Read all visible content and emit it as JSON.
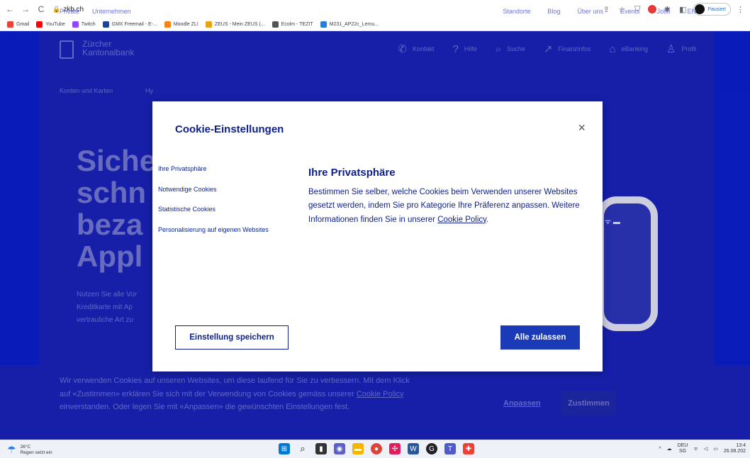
{
  "browser": {
    "url": "zkb.ch",
    "profile_label": "Pausiert",
    "bookmarks": [
      {
        "label": "Gmail",
        "color": "#ea4335"
      },
      {
        "label": "YouTube",
        "color": "#ff0000"
      },
      {
        "label": "Twitch",
        "color": "#9146ff"
      },
      {
        "label": "GMX Freemail - E-...",
        "color": "#1c449b"
      },
      {
        "label": "Moodle ZLI",
        "color": "#f98012"
      },
      {
        "label": "ZEUS - Mein ZEUS (...",
        "color": "#e8a317"
      },
      {
        "label": "Ecolm - TEZIT",
        "color": "#555555"
      },
      {
        "label": "M231_AP22c_Lernu...",
        "color": "#2b7cd3"
      }
    ]
  },
  "site": {
    "topnav_left": [
      "Private",
      "Unternehmen"
    ],
    "topnav_right": [
      "Standorte",
      "Blog",
      "Über uns",
      "Events",
      "Jobs",
      "EN"
    ],
    "logo_line1": "Zürcher",
    "logo_line2": "Kantonalbank",
    "mainnav": [
      {
        "label": "Kontakt",
        "icon": "phone-icon",
        "glyph": "✆"
      },
      {
        "label": "Hilfe",
        "icon": "help-icon",
        "glyph": "?"
      },
      {
        "label": "Suche",
        "icon": "search-icon",
        "glyph": "⌕"
      },
      {
        "label": "Finanzinfos",
        "icon": "chart-icon",
        "glyph": "↗"
      },
      {
        "label": "eBanking",
        "icon": "lock-icon",
        "glyph": "⌂"
      },
      {
        "label": "Profil",
        "icon": "user-icon",
        "glyph": "♙"
      }
    ],
    "menu_first": "Konten und Karten",
    "menu_second": "Hy",
    "hero_lines": [
      "Siche",
      "schn",
      "beza",
      "Appl"
    ],
    "hero_sub_lines": [
      "Nutzen Sie alle Vor",
      "Kreditkarte mit Ap",
      "vertrauliche Art zu"
    ]
  },
  "cookie_bar": {
    "text_before_link": "Wir verwenden Cookies auf unseren Websites, um diese laufend für Sie zu verbessern. Mit dem Klick auf «Zustimmen» erklären Sie sich mit der Verwendung von Cookies gemäss unserer ",
    "link": "Cookie Policy",
    "text_after_link": " einverstanden. Oder legen Sie mit «Anpassen» die gewünschten Einstellungen fest.",
    "anpassen": "Anpassen",
    "zustimmen": "Zustimmen"
  },
  "modal": {
    "title": "Cookie-Einstellungen",
    "close": "×",
    "nav": [
      "Ihre Privatsphäre",
      "Notwendige Cookies",
      "Statistische Cookies",
      "Personalisierung auf eigenen Websites"
    ],
    "section_title": "Ihre Privatsphäre",
    "section_text": "Bestimmen Sie selber, welche Cookies beim Verwenden unserer Websites gesetzt werden, indem Sie pro Kategorie Ihre Präferenz anpassen. Weitere Informationen finden Sie in unserer ",
    "section_link": "Cookie Policy",
    "section_end": ".",
    "save_button": "Einstellung speichern",
    "allow_button": "Alle zulassen"
  },
  "taskbar": {
    "temperature": "26°C",
    "weather": "Regen setzt ein",
    "lang1": "DEU",
    "lang2": "SG",
    "time": "13:4",
    "date": "26.08.202"
  }
}
